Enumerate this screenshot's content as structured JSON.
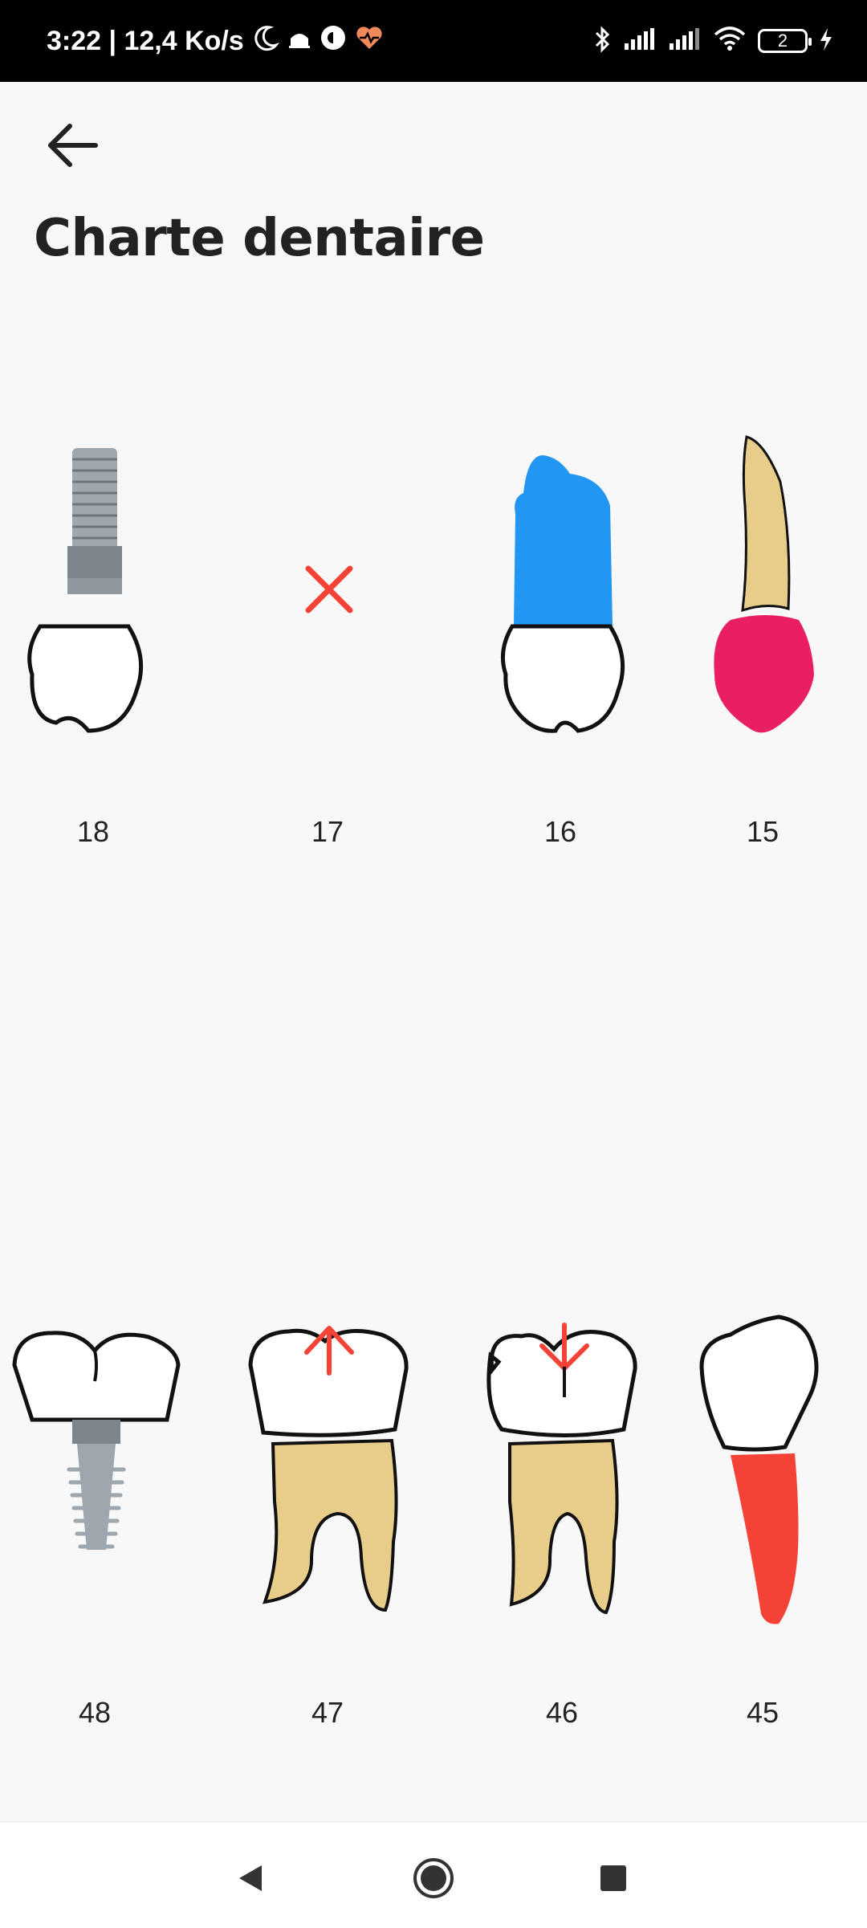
{
  "status_bar": {
    "time_speed": "3:22 | 12,4 Ko/s",
    "battery_level": "2",
    "icons": [
      "moon-icon",
      "mosque-icon",
      "app-icon",
      "health-icon",
      "bluetooth-icon",
      "signal-icon",
      "signal-icon",
      "wifi-icon",
      "battery-icon",
      "charging-icon"
    ]
  },
  "header": {
    "back_icon": "arrow-left-icon",
    "title": "Charte dentaire"
  },
  "upper_row": {
    "teeth": [
      {
        "number": "18",
        "state": "implant"
      },
      {
        "number": "17",
        "state": "missing"
      },
      {
        "number": "16",
        "state": "blue"
      },
      {
        "number": "15",
        "state": "pink-crown"
      }
    ]
  },
  "lower_row": {
    "teeth": [
      {
        "number": "48",
        "state": "implant"
      },
      {
        "number": "47",
        "state": "arrow-up"
      },
      {
        "number": "46",
        "state": "arrow-down-fractured"
      },
      {
        "number": "45",
        "state": "red-root"
      }
    ]
  },
  "colors": {
    "status_bg": "#000000",
    "page_bg": "#f8f8f8",
    "root_beige": "#e8cc8a",
    "blue": "#2196f3",
    "pink": "#e91e63",
    "red": "#f44336",
    "implant_grey": "#9ea7ad"
  },
  "nav_bar": {
    "back_icon": "triangle-back-icon",
    "home_icon": "circle-home-icon",
    "recents_icon": "square-recents-icon"
  }
}
